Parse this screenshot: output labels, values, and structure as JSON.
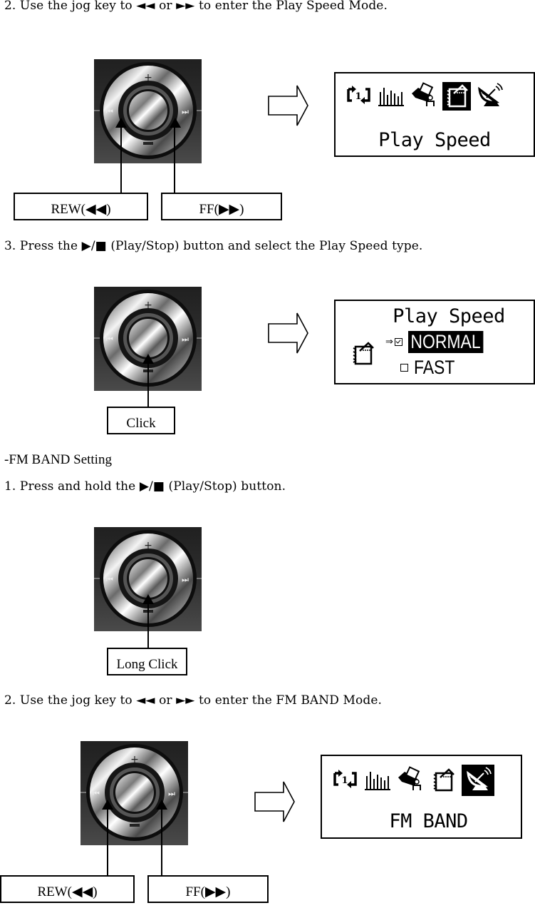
{
  "sections": {
    "play_speed_step2": {
      "instruction": "2. Use the jog key to ◄◄ or ►► to enter the Play Speed Mode.",
      "rew_label": "REW(◀◀)",
      "ff_label": "FF(▶▶)",
      "lcd": {
        "icons": [
          "repeat-one-icon",
          "equalizer-icon",
          "user-folder-icon",
          "play-speed-notepad-icon",
          "fm-antenna-icon"
        ],
        "selected_icon": "play-speed-notepad-icon",
        "title": "Play Speed"
      }
    },
    "play_speed_step3": {
      "instruction": "3. Press the ▶/■ (Play/Stop) button and select the Play Speed type.",
      "click_label": "Click",
      "lcd": {
        "title": "Play Speed",
        "options": [
          {
            "label": "NORMAL",
            "checked": true,
            "highlighted": true,
            "pointer": "⇒"
          },
          {
            "label": "FAST",
            "checked": false,
            "highlighted": false,
            "pointer": ""
          }
        ]
      }
    },
    "fm_band": {
      "heading": "-FM BAND Setting",
      "step1_instruction": "1. Press and hold the ▶/■ (Play/Stop) button.",
      "long_click_label": "Long Click",
      "step2_instruction": "2. Use the jog key to ◄◄ or ►► to enter the FM BAND Mode.",
      "rew_label": "REW(◀◀)",
      "ff_label": "FF(▶▶)",
      "lcd": {
        "icons": [
          "repeat-one-icon",
          "equalizer-icon",
          "user-folder-icon",
          "play-speed-notepad-icon",
          "fm-antenna-icon"
        ],
        "selected_icon": "fm-antenna-icon",
        "title": "FM BAND"
      }
    }
  },
  "jog_markings": {
    "plus": "+",
    "minus": "−",
    "rew": "⏮",
    "ff": "⏭"
  }
}
